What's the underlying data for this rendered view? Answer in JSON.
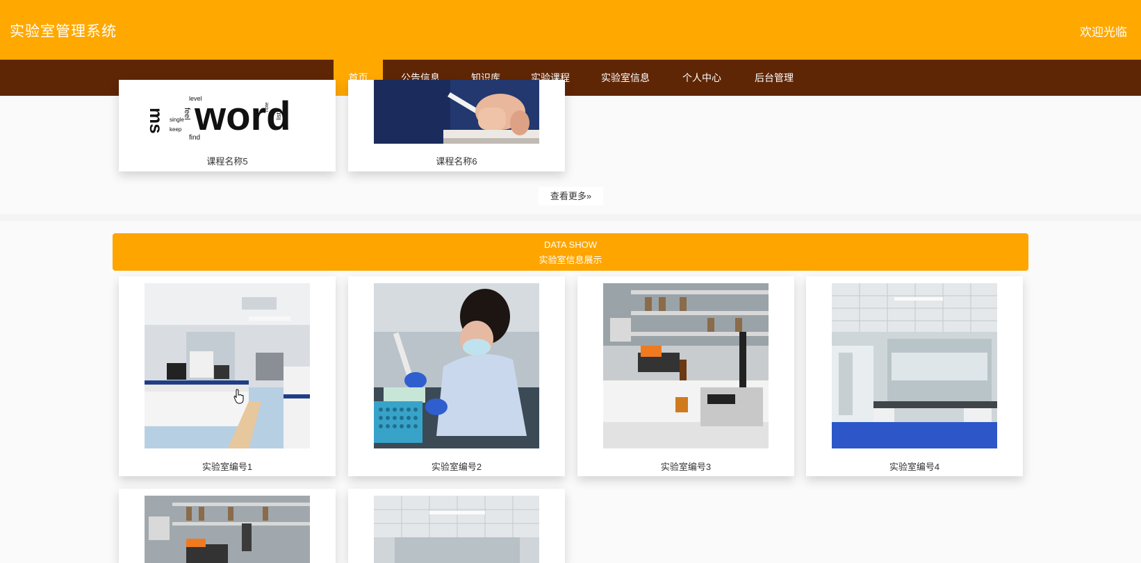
{
  "header": {
    "site_title": "实验室管理系统",
    "welcome": "欢迎光临",
    "color": "#ffa800"
  },
  "nav": {
    "color": "#5f2606",
    "items": [
      {
        "label": "首页",
        "active": true
      },
      {
        "label": "公告信息"
      },
      {
        "label": "知识库"
      },
      {
        "label": "实验课程"
      },
      {
        "label": "实验室信息"
      },
      {
        "label": "个人中心"
      },
      {
        "label": "后台管理"
      }
    ]
  },
  "courses": {
    "items": [
      {
        "name": "课程名称5",
        "image": "word-cloud-image"
      },
      {
        "name": "课程名称6",
        "image": "hand-on-book-image"
      }
    ],
    "more_label": "查看更多"
  },
  "labs": {
    "banner_en": "DATA SHOW",
    "banner_cn": "实验室信息展示",
    "items": [
      {
        "name": "实验室编号1",
        "image": "lab-room-image"
      },
      {
        "name": "实验室编号2",
        "image": "researcher-pipette-image"
      },
      {
        "name": "实验室编号3",
        "image": "lab-bench-instruments-image"
      },
      {
        "name": "实验室编号4",
        "image": "empty-lab-image"
      },
      {
        "name": "",
        "image": "lab-shelves-image"
      },
      {
        "name": "",
        "image": "lab-ceiling-image"
      }
    ]
  }
}
